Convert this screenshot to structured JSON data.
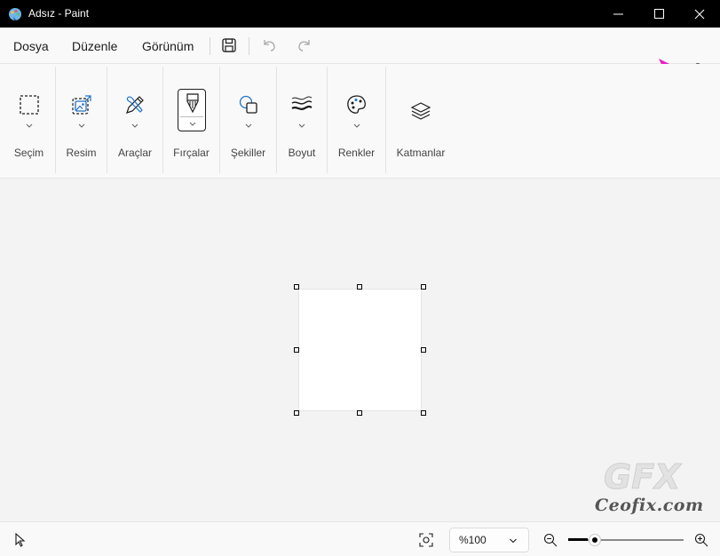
{
  "window": {
    "title": "Adsız - Paint"
  },
  "menu": {
    "file": "Dosya",
    "edit": "Düzenle",
    "view": "Görünüm"
  },
  "ribbon": {
    "groups": [
      {
        "label": "Seçim",
        "icon": "selection-icon"
      },
      {
        "label": "Resim",
        "icon": "image-icon"
      },
      {
        "label": "Araçlar",
        "icon": "tools-icon"
      },
      {
        "label": "Fırçalar",
        "icon": "brush-icon"
      },
      {
        "label": "Şekiller",
        "icon": "shapes-icon"
      },
      {
        "label": "Boyut",
        "icon": "size-icon"
      },
      {
        "label": "Renkler",
        "icon": "palette-icon"
      },
      {
        "label": "Katmanlar",
        "icon": "layers-icon"
      }
    ]
  },
  "status": {
    "zoom_label": "%100",
    "zoom_level": 0.12
  },
  "watermark": {
    "text": "Ceofix.com",
    "logo": "GFX"
  },
  "colors": {
    "annotation_arrow": "#e91ec4",
    "titlebar": "#000000"
  }
}
